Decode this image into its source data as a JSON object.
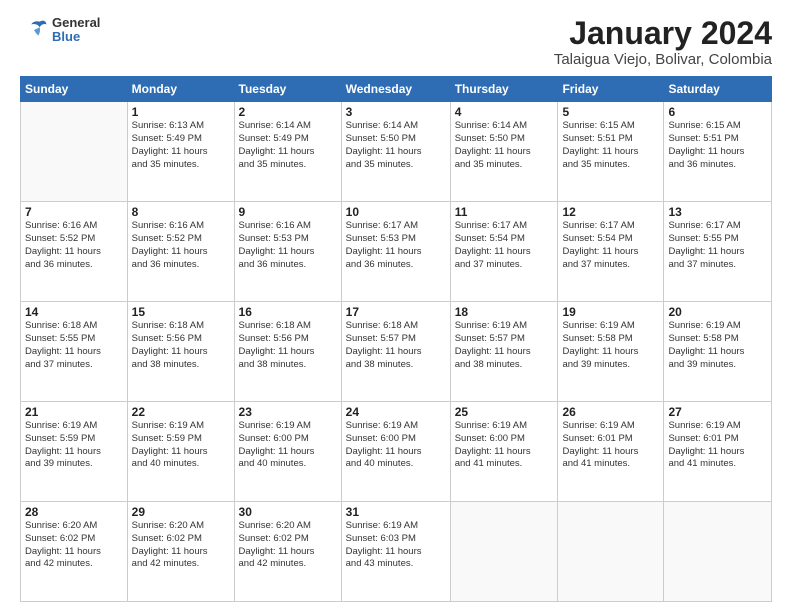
{
  "header": {
    "logo": {
      "general": "General",
      "blue": "Blue"
    },
    "title": "January 2024",
    "subtitle": "Talaigua Viejo, Bolivar, Colombia"
  },
  "days_of_week": [
    "Sunday",
    "Monday",
    "Tuesday",
    "Wednesday",
    "Thursday",
    "Friday",
    "Saturday"
  ],
  "weeks": [
    [
      {
        "day": "",
        "info": ""
      },
      {
        "day": "1",
        "info": "Sunrise: 6:13 AM\nSunset: 5:49 PM\nDaylight: 11 hours\nand 35 minutes."
      },
      {
        "day": "2",
        "info": "Sunrise: 6:14 AM\nSunset: 5:49 PM\nDaylight: 11 hours\nand 35 minutes."
      },
      {
        "day": "3",
        "info": "Sunrise: 6:14 AM\nSunset: 5:50 PM\nDaylight: 11 hours\nand 35 minutes."
      },
      {
        "day": "4",
        "info": "Sunrise: 6:14 AM\nSunset: 5:50 PM\nDaylight: 11 hours\nand 35 minutes."
      },
      {
        "day": "5",
        "info": "Sunrise: 6:15 AM\nSunset: 5:51 PM\nDaylight: 11 hours\nand 35 minutes."
      },
      {
        "day": "6",
        "info": "Sunrise: 6:15 AM\nSunset: 5:51 PM\nDaylight: 11 hours\nand 36 minutes."
      }
    ],
    [
      {
        "day": "7",
        "info": "Sunrise: 6:16 AM\nSunset: 5:52 PM\nDaylight: 11 hours\nand 36 minutes."
      },
      {
        "day": "8",
        "info": "Sunrise: 6:16 AM\nSunset: 5:52 PM\nDaylight: 11 hours\nand 36 minutes."
      },
      {
        "day": "9",
        "info": "Sunrise: 6:16 AM\nSunset: 5:53 PM\nDaylight: 11 hours\nand 36 minutes."
      },
      {
        "day": "10",
        "info": "Sunrise: 6:17 AM\nSunset: 5:53 PM\nDaylight: 11 hours\nand 36 minutes."
      },
      {
        "day": "11",
        "info": "Sunrise: 6:17 AM\nSunset: 5:54 PM\nDaylight: 11 hours\nand 37 minutes."
      },
      {
        "day": "12",
        "info": "Sunrise: 6:17 AM\nSunset: 5:54 PM\nDaylight: 11 hours\nand 37 minutes."
      },
      {
        "day": "13",
        "info": "Sunrise: 6:17 AM\nSunset: 5:55 PM\nDaylight: 11 hours\nand 37 minutes."
      }
    ],
    [
      {
        "day": "14",
        "info": "Sunrise: 6:18 AM\nSunset: 5:55 PM\nDaylight: 11 hours\nand 37 minutes."
      },
      {
        "day": "15",
        "info": "Sunrise: 6:18 AM\nSunset: 5:56 PM\nDaylight: 11 hours\nand 38 minutes."
      },
      {
        "day": "16",
        "info": "Sunrise: 6:18 AM\nSunset: 5:56 PM\nDaylight: 11 hours\nand 38 minutes."
      },
      {
        "day": "17",
        "info": "Sunrise: 6:18 AM\nSunset: 5:57 PM\nDaylight: 11 hours\nand 38 minutes."
      },
      {
        "day": "18",
        "info": "Sunrise: 6:19 AM\nSunset: 5:57 PM\nDaylight: 11 hours\nand 38 minutes."
      },
      {
        "day": "19",
        "info": "Sunrise: 6:19 AM\nSunset: 5:58 PM\nDaylight: 11 hours\nand 39 minutes."
      },
      {
        "day": "20",
        "info": "Sunrise: 6:19 AM\nSunset: 5:58 PM\nDaylight: 11 hours\nand 39 minutes."
      }
    ],
    [
      {
        "day": "21",
        "info": "Sunrise: 6:19 AM\nSunset: 5:59 PM\nDaylight: 11 hours\nand 39 minutes."
      },
      {
        "day": "22",
        "info": "Sunrise: 6:19 AM\nSunset: 5:59 PM\nDaylight: 11 hours\nand 40 minutes."
      },
      {
        "day": "23",
        "info": "Sunrise: 6:19 AM\nSunset: 6:00 PM\nDaylight: 11 hours\nand 40 minutes."
      },
      {
        "day": "24",
        "info": "Sunrise: 6:19 AM\nSunset: 6:00 PM\nDaylight: 11 hours\nand 40 minutes."
      },
      {
        "day": "25",
        "info": "Sunrise: 6:19 AM\nSunset: 6:00 PM\nDaylight: 11 hours\nand 41 minutes."
      },
      {
        "day": "26",
        "info": "Sunrise: 6:19 AM\nSunset: 6:01 PM\nDaylight: 11 hours\nand 41 minutes."
      },
      {
        "day": "27",
        "info": "Sunrise: 6:19 AM\nSunset: 6:01 PM\nDaylight: 11 hours\nand 41 minutes."
      }
    ],
    [
      {
        "day": "28",
        "info": "Sunrise: 6:20 AM\nSunset: 6:02 PM\nDaylight: 11 hours\nand 42 minutes."
      },
      {
        "day": "29",
        "info": "Sunrise: 6:20 AM\nSunset: 6:02 PM\nDaylight: 11 hours\nand 42 minutes."
      },
      {
        "day": "30",
        "info": "Sunrise: 6:20 AM\nSunset: 6:02 PM\nDaylight: 11 hours\nand 42 minutes."
      },
      {
        "day": "31",
        "info": "Sunrise: 6:19 AM\nSunset: 6:03 PM\nDaylight: 11 hours\nand 43 minutes."
      },
      {
        "day": "",
        "info": ""
      },
      {
        "day": "",
        "info": ""
      },
      {
        "day": "",
        "info": ""
      }
    ]
  ]
}
